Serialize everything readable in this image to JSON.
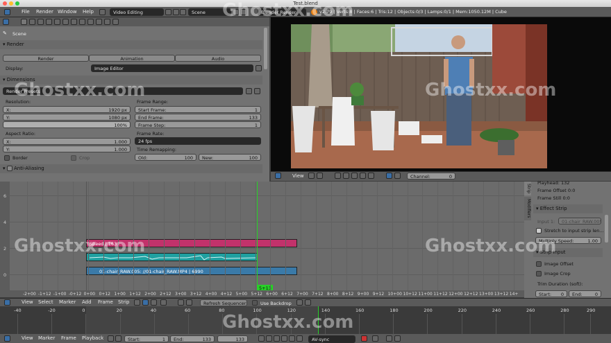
{
  "window": {
    "title": "Test.blend"
  },
  "menubar": {
    "items": [
      "File",
      "Render",
      "Window",
      "Help"
    ],
    "layout": "Video Editing",
    "scene": "Scene",
    "engine": "Blender Render",
    "stats": "v2.79 | Verts:8 | Faces:6 | Tris:12 | Objects:0/3 | Lamps:0/1 | Mem:1050.12M | Cube"
  },
  "props": {
    "context": "Scene",
    "render_panel": "Render",
    "render_btn": "Render",
    "animation_btn": "Animation",
    "audio_btn": "Audio",
    "display_label": "Display:",
    "display_value": "Image Editor",
    "dimensions_panel": "Dimensions",
    "render_presets": "Render Presets",
    "resolution_label": "Resolution:",
    "res_x": "X:",
    "res_x_val": "1920 px",
    "res_y": "Y:",
    "res_y_val": "1080 px",
    "res_pct": "100%",
    "aspect_label": "Aspect Ratio:",
    "asp_x": "X:",
    "asp_x_val": "1.000",
    "asp_y": "Y:",
    "asp_y_val": "1.000",
    "border": "Border",
    "crop": "Crop",
    "frame_range_label": "Frame Range:",
    "start_frame": "Start Frame:",
    "start_val": "1",
    "end_frame": "End Frame:",
    "end_val": "133",
    "frame_step": "Frame Step:",
    "step_val": "1",
    "frame_rate_label": "Frame Rate:",
    "frame_rate_val": "24 fps",
    "time_remap_label": "Time Remapping:",
    "old": "Old:",
    "old_val": "100",
    "new": "New:",
    "new_val": "100",
    "antialias_panel": "Anti-Aliasing"
  },
  "seq_header": {
    "view": "View",
    "channel": "Channel:",
    "channel_val": "0"
  },
  "sequencer": {
    "y_labels": [
      "6",
      "4",
      "2",
      "0"
    ],
    "strips": [
      {
        "label": "Speed | 163",
        "color": "#c2326b"
      },
      {
        "label": "",
        "color": "#1fa0a0"
      },
      {
        "label": "01-chair_RAW.005: //01-chair_RAW.MP4 | 6990",
        "color": "#3a7aa8"
      }
    ],
    "playhead": "5+13",
    "x_ticks": [
      "-2+00",
      "-1+12",
      "-1+00",
      "-0+12",
      "0+00",
      "0+12",
      "1+00",
      "1+12",
      "2+00",
      "2+12",
      "3+00",
      "3+12",
      "4+00",
      "4+12",
      "5+00",
      "5+12",
      "6+00",
      "6+12",
      "7+00",
      "7+12",
      "8+00",
      "8+12",
      "9+00",
      "9+12",
      "10+00",
      "10+12",
      "11+00",
      "11+12",
      "12+00",
      "12+12",
      "13+00",
      "13+12",
      "14+"
    ]
  },
  "sidebar": {
    "tabs": [
      "Strip",
      "Modifiers"
    ],
    "playhead": "Playhead: 132",
    "frame_offset": "Frame Offset 0:0",
    "frame_still": "Frame Still 0:0",
    "effect_strip": "Effect Strip",
    "input1": "Input 1:",
    "input1_val": "01-chair_RAW.005",
    "stretch": "Stretch to input strip len...",
    "multiply": "Multiply Speed:",
    "multiply_val": "1.00",
    "strip_input": "Strip Input",
    "image_offset": "Image Offset",
    "image_crop": "Image Crop",
    "trim": "Trim Duration (soft):",
    "start": "Start:",
    "start_val": "0",
    "end": "End:",
    "end_val": "0"
  },
  "seq_menu": {
    "items": [
      "View",
      "Select",
      "Marker",
      "Add",
      "Frame",
      "Strip"
    ],
    "refresh": "Refresh Sequencer",
    "use_backdrop": "Use Backdrop"
  },
  "timeline": {
    "ticks": [
      "-40",
      "-20",
      "0",
      "20",
      "40",
      "60",
      "80",
      "100",
      "120",
      "140",
      "160",
      "180",
      "200",
      "220",
      "240",
      "260",
      "280",
      "290"
    ]
  },
  "timeline_menu": {
    "items": [
      "View",
      "Marker",
      "Frame",
      "Playback"
    ],
    "start": "Start:",
    "start_val": "1",
    "end": "End:",
    "end_val": "133",
    "current": "133",
    "sync": "AV-sync"
  },
  "watermarks": [
    "Ghostxx.com",
    "Ghostxx.com",
    "Ghostxx.com",
    "Ghostxx.com",
    "Ghostxx.com",
    "Ghostxx.com"
  ]
}
